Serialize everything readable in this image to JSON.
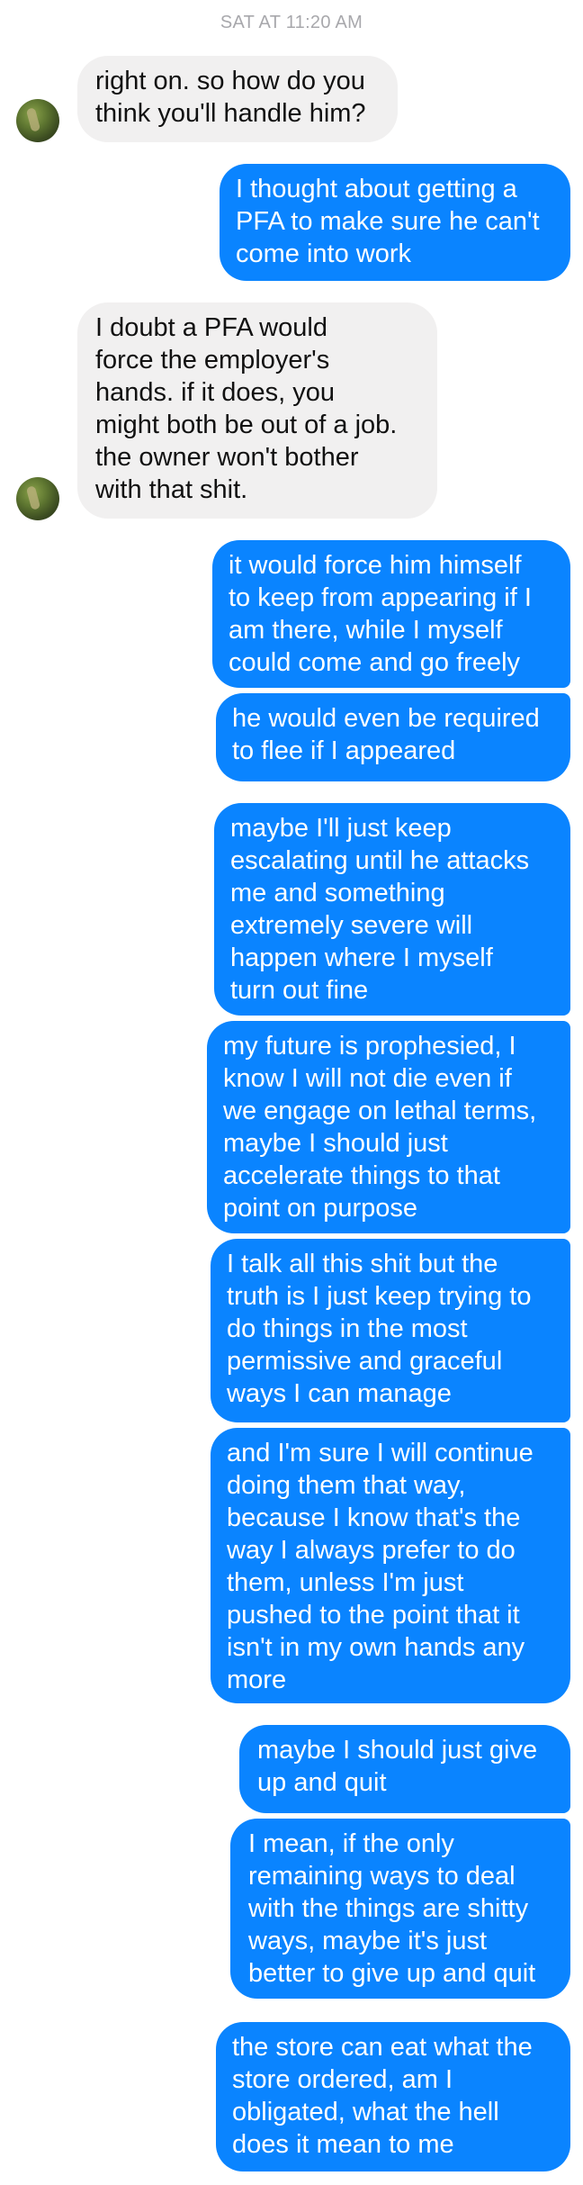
{
  "conversation": {
    "timestamp": "SAT AT 11:20 AM",
    "messages": [
      {
        "from": "them",
        "text": "right on. so how do you\nthink you'll handle him?"
      },
      {
        "from": "me",
        "text": "I thought about getting a\nPFA to make sure he can't\ncome into work"
      },
      {
        "from": "them",
        "text": "I doubt a PFA would\nforce the employer's\nhands. if it does, you\nmight both be out of a job.\nthe owner won't bother\nwith that shit."
      },
      {
        "from": "me",
        "text": "it would force him himself\nto keep from appearing if I\nam there, while I myself\ncould come and go freely"
      },
      {
        "from": "me",
        "text": "he would even be required\nto flee if I appeared"
      },
      {
        "from": "me",
        "text": "maybe I'll just keep\nescalating until he attacks\nme and something\nextremely severe will\nhappen where I myself\nturn out fine"
      },
      {
        "from": "me",
        "text": "my future is prophesied, I\nknow I will not die even if\nwe engage on lethal terms,\nmaybe I should just\naccelerate things to that\npoint on purpose"
      },
      {
        "from": "me",
        "text": "I talk all this shit but the\ntruth is I just keep trying to\ndo things in the most\npermissive and graceful\nways I can manage"
      },
      {
        "from": "me",
        "text": "and I'm sure I will continue\ndoing them that way,\nbecause I know that's the\nway I always prefer to do\nthem, unless I'm just\npushed to the point that it\nisn't in my own hands any\nmore"
      },
      {
        "from": "me",
        "text": "maybe I should just give\nup and quit"
      },
      {
        "from": "me",
        "text": "I mean, if the only\nremaining ways to deal\nwith the things are shitty\nways, maybe it's just\nbetter to give up and quit"
      },
      {
        "from": "me",
        "text": "the store can eat what the\nstore ordered, am I\nobligated, what the hell\ndoes it mean to me"
      }
    ]
  },
  "colors": {
    "outgoing_bubble": "#0a84ff",
    "incoming_bubble": "#f1f0f0",
    "timestamp": "#a8a8ac"
  }
}
